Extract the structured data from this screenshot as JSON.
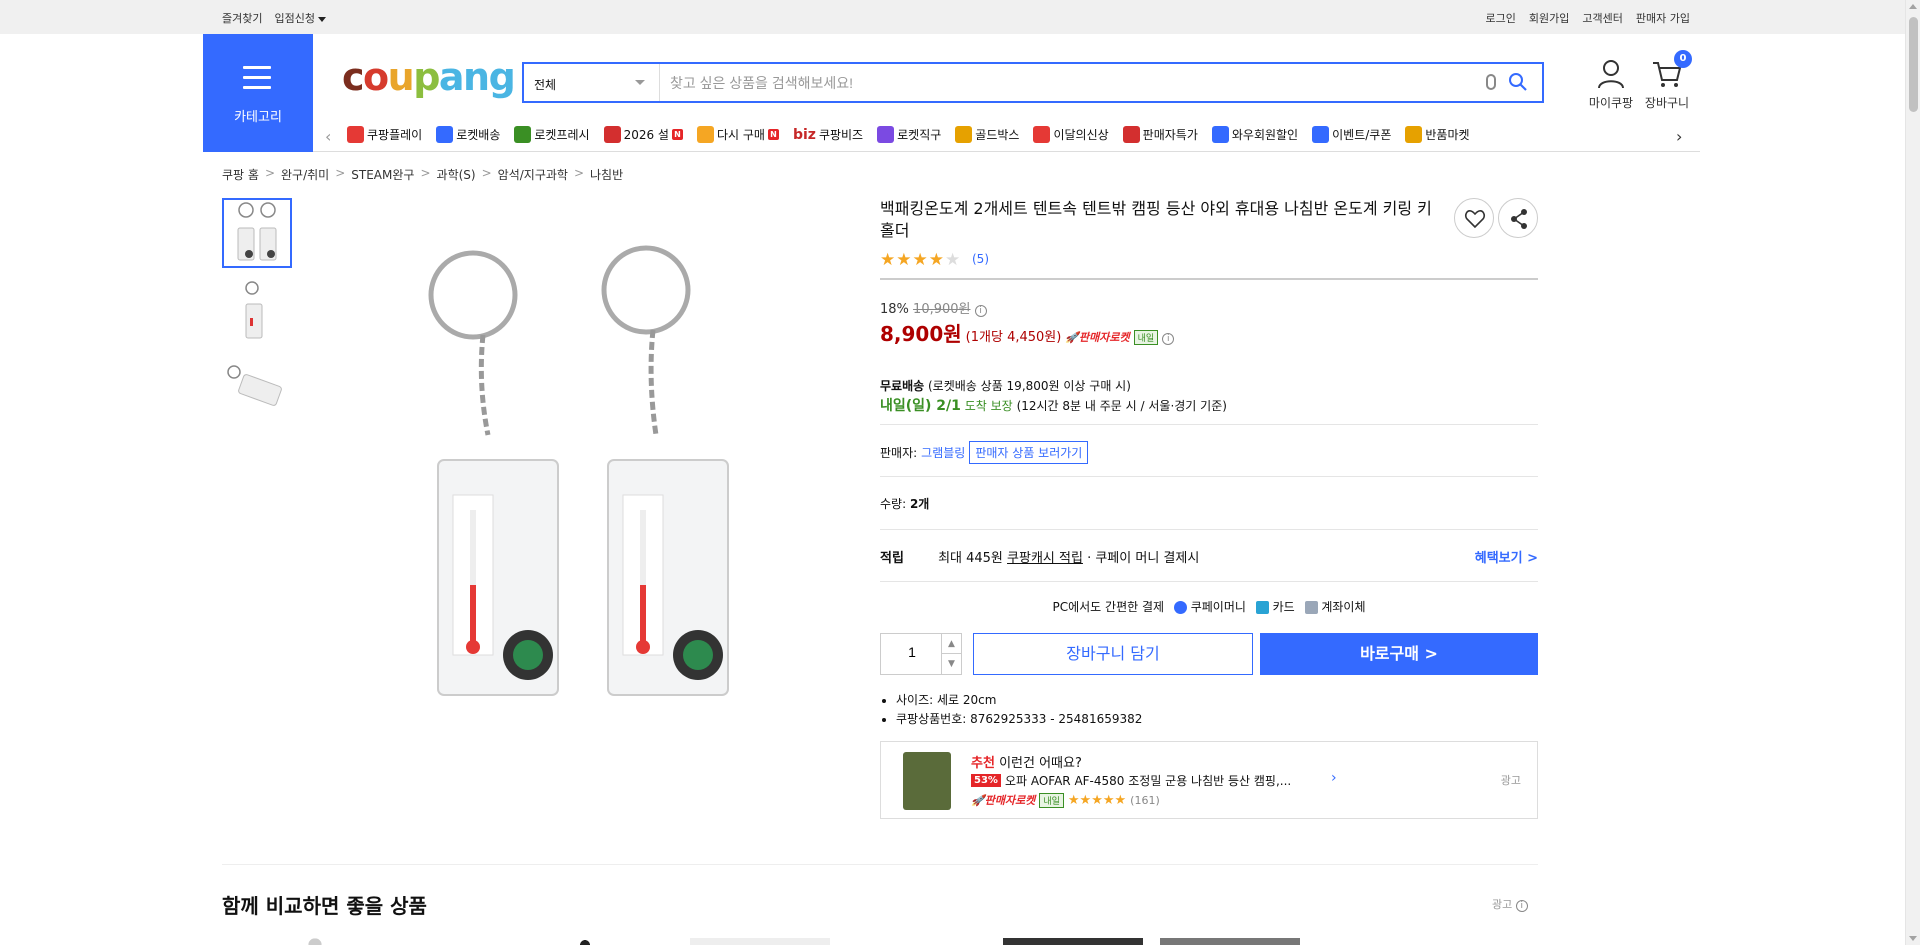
{
  "topbar": {
    "bookmark": "즐겨찾기",
    "partner": "입점신청",
    "login": "로그인",
    "signup": "회원가입",
    "cs": "고객센터",
    "seller_signup": "판매자 가입"
  },
  "header": {
    "category_label": "카테고리",
    "logo_parts": [
      "c",
      "o",
      "u",
      "p",
      "ang"
    ],
    "search_scope": "전체",
    "search_placeholder": "찾고 싶은 상품을 검색해보세요!",
    "my_coupang": "마이쿠팡",
    "cart": "장바구니",
    "cart_count": "0"
  },
  "catnav": {
    "items": [
      {
        "label": "쿠팡플레이",
        "color": "#e53935"
      },
      {
        "label": "로켓배송",
        "color": "#346aff"
      },
      {
        "label": "로켓프레시",
        "color": "#3a8f24"
      },
      {
        "label": "2026 설",
        "color": "#d32f2f",
        "badge": "N"
      },
      {
        "label": "다시 구매",
        "color": "#f5a623",
        "badge": "N"
      },
      {
        "label": "쿠팡비즈",
        "color": "#c62828",
        "prefix": "biz"
      },
      {
        "label": "로켓직구",
        "color": "#7b4ae2"
      },
      {
        "label": "골드박스",
        "color": "#e6a100"
      },
      {
        "label": "이달의신상",
        "color": "#e53935"
      },
      {
        "label": "판매자특가",
        "color": "#d32f2f"
      },
      {
        "label": "와우회원할인",
        "color": "#346aff"
      },
      {
        "label": "이벤트/쿠폰",
        "color": "#346aff"
      },
      {
        "label": "반품마켓",
        "color": "#e6a100"
      }
    ]
  },
  "breadcrumb": [
    "쿠팡 홈",
    "완구/취미",
    "STEAM완구",
    "과학(S)",
    "암석/지구과학",
    "나침반"
  ],
  "product": {
    "title": "백패킹온도계 2개세트 텐트속 텐트밖 캠핑 등산 야외 휴대용 나침반 온도계 키링 키홀더",
    "rating": 4,
    "review_count": "(5)",
    "discount_rate": "18%",
    "original_price": "10,900원",
    "price": "8,900원",
    "unit_price": "(1개당 4,450원)",
    "rocket_label": "판매자로켓",
    "naeil_badge": "내일",
    "shipping_title": "무료배송",
    "shipping_desc": "(로켓배송 상품 19,800원 이상 구매 시)",
    "arrival": "내일(일) 2/1",
    "arrival_suffix": "도착 보장",
    "arrival_note": "(12시간 8분 내 주문 시 / 서울·경기 기준)",
    "seller_label": "판매자:",
    "seller_name": "그램블링",
    "seller_button": "판매자 상품 보러가기",
    "qty_label": "수량:",
    "qty_value": "2개",
    "reward_label": "적립",
    "reward_text_1": "최대 445원",
    "reward_text_2": "쿠팡캐시 적립",
    "reward_text_3": "· 쿠페이 머니 결제시",
    "benefit_link": "혜택보기 >",
    "pay_label": "PC에서도 간편한 결제",
    "pay_methods": [
      "쿠페이머니",
      "카드",
      "계좌이체"
    ],
    "quantity_input": "1",
    "add_cart": "장바구니 담기",
    "buy_now": "바로구매 >",
    "spec_size": "사이즈: 세로 20cm",
    "spec_id": "쿠팡상품번호: 8762925333 - 25481659382"
  },
  "recommend": {
    "title_red": "추천",
    "title_rest": "이런건 어때요?",
    "discount": "53%",
    "name": "오파 AOFAR AF-4580 조정밀 군용 나침반 등산 캠핑,...",
    "rocket": "판매자로켓",
    "naeil": "내일",
    "rating": 4.5,
    "reviews": "(161)",
    "ad": "광고"
  },
  "compare": {
    "title": "함께 비교하면 좋을 상품",
    "ad": "광고"
  }
}
